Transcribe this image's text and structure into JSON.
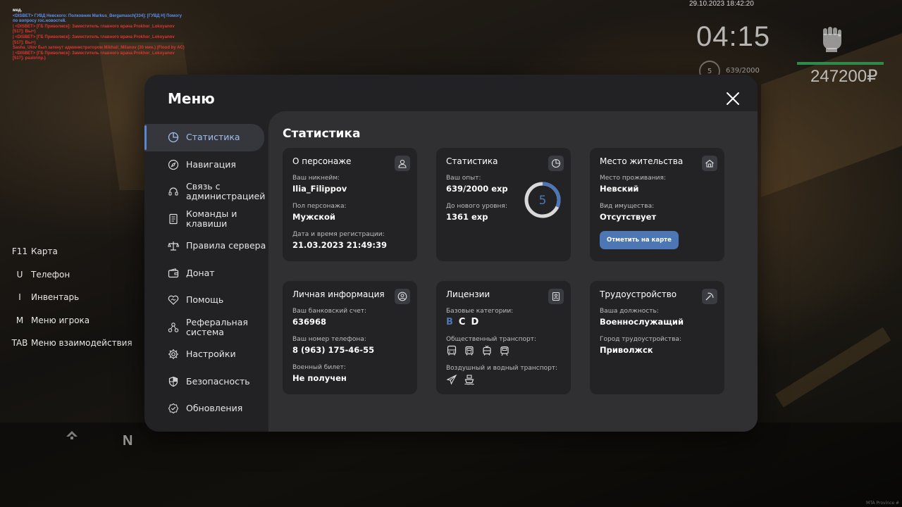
{
  "chat": {
    "lines": [
      {
        "text": "мед.",
        "color": "white"
      },
      {
        "text": "<DISBET> ГУВД Невского: Полковник Markus_Bergamasch[334]: [ГУВД Н] Помогу по вопросу гос.новостей.",
        "color": "blue"
      },
      {
        "text": "| <DISBET> [ГБ Приволжск]: Заместитель главного врача Prokhor_Lokoyanov [517]: Вы+)",
        "color": "red"
      },
      {
        "text": "| <DISBET> [ГБ Приволжск]: Заместитель главного врача Prokhor_Lokoyanov [517]: Вы+)",
        "color": "red"
      },
      {
        "text": "Sasha_Ulov был заткнут администратором Mikhail_Milanov (30 мин.) (Flood by AC)",
        "color": "red"
      },
      {
        "text": "| <DISBET> [ГБ Приволжск]: Заместитель главного врача Prokhor_Lokoyanov [517]: раз/отпр.)",
        "color": "red"
      }
    ]
  },
  "hud": {
    "datetime": "29.10.2023 18:42:20",
    "time": "04:15",
    "level": "5",
    "exp": "639/2000",
    "money": "247200₽",
    "health_color": "#2f8b4a"
  },
  "keys": [
    {
      "key": "F11",
      "label": "Карта"
    },
    {
      "key": "U",
      "label": "Телефон"
    },
    {
      "key": "I",
      "label": "Инвентарь"
    },
    {
      "key": "M",
      "label": "Меню игрока"
    },
    {
      "key": "TAB",
      "label": "Меню взаимодействия"
    }
  ],
  "compass": {
    "north": "N"
  },
  "watermark": "MTA Province #",
  "menu": {
    "title": "Меню",
    "nav": [
      {
        "label": "Статистика",
        "icon": "pie-chart-icon",
        "active": true
      },
      {
        "label": "Навигация",
        "icon": "compass-icon"
      },
      {
        "label": "Связь с администрацией",
        "icon": "headset-icon"
      },
      {
        "label": "Команды и клавиши",
        "icon": "document-icon"
      },
      {
        "label": "Правила сервера",
        "icon": "scales-icon"
      },
      {
        "label": "Донат",
        "icon": "wallet-icon"
      },
      {
        "label": "Помощь",
        "icon": "handshake-heart-icon"
      },
      {
        "label": "Реферальная система",
        "icon": "network-icon"
      },
      {
        "label": "Настройки",
        "icon": "gear-icon"
      },
      {
        "label": "Безопасность",
        "icon": "shield-icon"
      },
      {
        "label": "Обновления",
        "icon": "check-badge-icon"
      }
    ],
    "content_title": "Статистика",
    "accent": "#4d76b5",
    "cards": {
      "character": {
        "title": "О персонаже",
        "nickname_label": "Ваш никнейм:",
        "nickname": "Ilia_Filippov",
        "gender_label": "Пол персонажа:",
        "gender": "Мужской",
        "reg_label": "Дата и время регистрации:",
        "reg": "21.03.2023 21:49:39"
      },
      "stats": {
        "title": "Статистика",
        "exp_label": "Ваш опыт:",
        "exp": "639/2000 exp",
        "next_label": "До нового уровня:",
        "next": "1361 exp",
        "level": "5",
        "progress": 0.3195
      },
      "residence": {
        "title": "Место жительства",
        "place_label": "Место проживания:",
        "place": "Невский",
        "property_label": "Вид имущества:",
        "property": "Отсутствует",
        "map_button": "Отметить на карте"
      },
      "personal": {
        "title": "Личная информация",
        "bank_label": "Ваш банковский счет:",
        "bank": "636968",
        "phone_label": "Ваш номер телефона:",
        "phone": "8 (963) 175-46-55",
        "military_label": "Военный билет:",
        "military": "Не получен"
      },
      "licenses": {
        "title": "Лицензии",
        "base_label": "Базовые категории:",
        "categories": [
          {
            "name": "B",
            "owned": true
          },
          {
            "name": "C",
            "owned": false
          },
          {
            "name": "D",
            "owned": false
          }
        ],
        "public_label": "Общественный транспорт:",
        "public_icons": [
          "bus-icon",
          "trolleybus-icon",
          "tram-icon",
          "metro-icon"
        ],
        "air_label": "Воздушный и водный транспорт:",
        "air_icons": [
          "plane-icon",
          "boat-icon"
        ]
      },
      "employment": {
        "title": "Трудоустройство",
        "position_label": "Ваша должность:",
        "position": "Военнослужащий",
        "city_label": "Город трудоустройства:",
        "city": "Приволжск"
      }
    }
  }
}
